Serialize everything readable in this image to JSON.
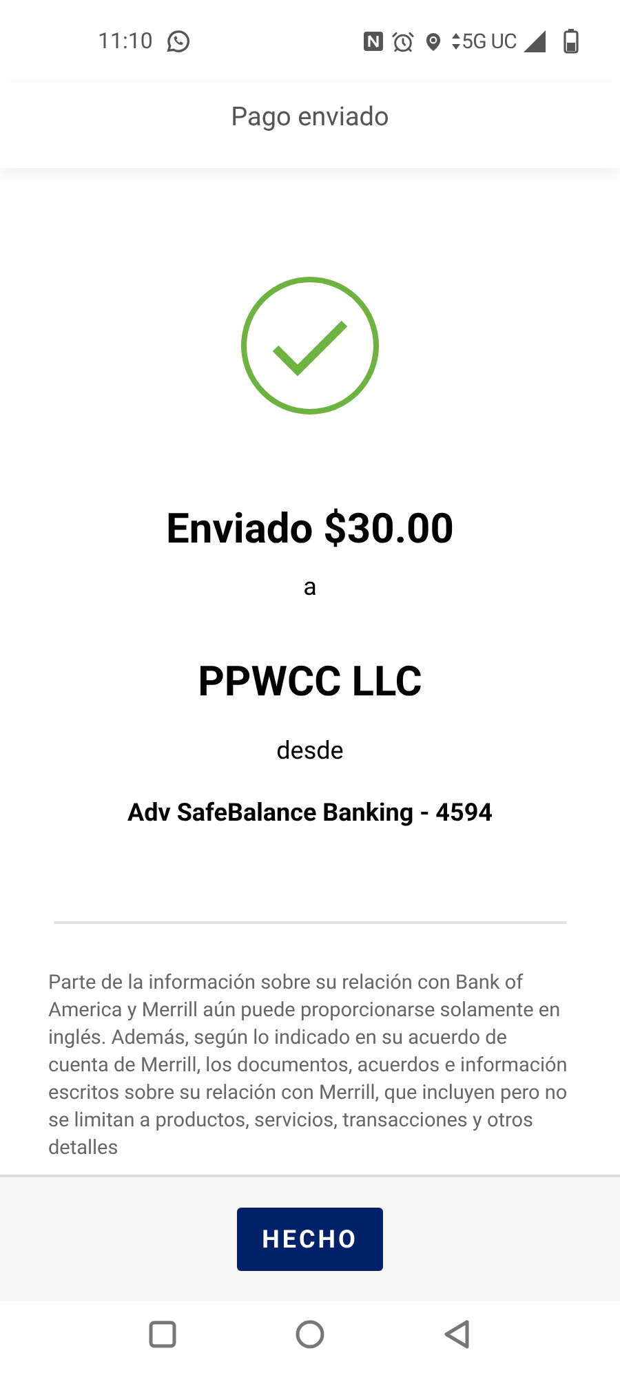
{
  "status_bar": {
    "time": "11:10",
    "network": "5G UC"
  },
  "header": {
    "title": "Pago enviado"
  },
  "confirmation": {
    "amount_line": "Enviado $30.00",
    "to_label": "a",
    "payee": "PPWCC LLC",
    "from_label": "desde",
    "account": "Adv SafeBalance Banking - 4594"
  },
  "disclaimer": "Parte de la información sobre su relación con Bank of America y Merrill aún puede proporcionarse solamente en inglés. Además, según lo indicado en su acuerdo de cuenta de Merrill, los documentos, acuerdos e información escritos sobre su relación con Merrill, que incluyen pero no se limitan a productos, servicios, transacciones y otros detalles",
  "footer": {
    "button": "HECHO"
  }
}
